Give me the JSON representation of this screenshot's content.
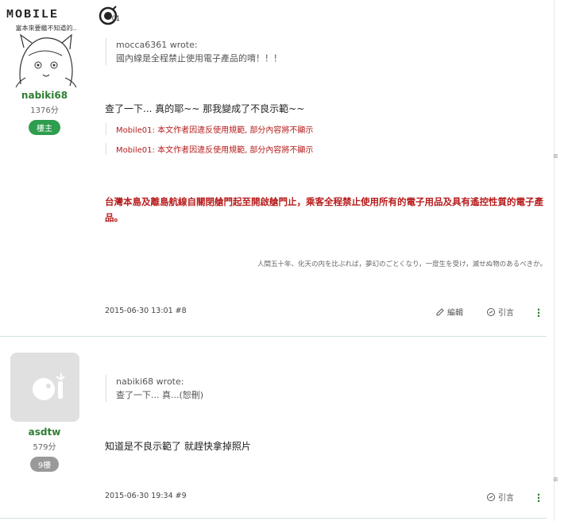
{
  "site": {
    "logo_text": "MOBILE"
  },
  "posts": [
    {
      "user": {
        "avatar_caption": "富本來要繼不知道的..",
        "name": "nabiki68",
        "score": "1376分",
        "badge": "樓主"
      },
      "quote": {
        "author": "mocca6361 wrote:",
        "text": "國內線是全程禁止使用電子產品的唷！！！"
      },
      "body": "查了一下... 真的耶~~ 那我變成了不良示範~~",
      "censored": [
        "Mobile01: 本文作者因違反使用規範, 部分內容將不顯示",
        "Mobile01: 本文作者因違反使用規範, 部分內容將不顯示"
      ],
      "notice": "台灣本島及離島航線自關閉艙門起至開啟艙門止，乘客全程禁止使用所有的電子用品及具有遙控性質的電子產品。",
      "signature": "人間五十年、化天の内を比ぶれば，夢幻のごとくなり，一度生を受け，滅せぬ物のあるべきか。",
      "meta": "2015-06-30 13:01 #8",
      "actions": {
        "edit": "編輯",
        "quote": "引言"
      }
    },
    {
      "user": {
        "name": "asdtw",
        "score": "579分",
        "badge": "9樓"
      },
      "quote": {
        "author": "nabiki68 wrote:",
        "text": "查了一下... 真...(恕刪)"
      },
      "body": "知道是不良示範了 就趕快拿掉照片",
      "meta": "2015-06-30 19:34 #9",
      "actions": {
        "quote": "引言"
      }
    }
  ],
  "rail": {
    "mark": "ꕥ"
  },
  "colors": {
    "accent_green": "#2e7d32",
    "notice_red": "#b71c1c"
  }
}
